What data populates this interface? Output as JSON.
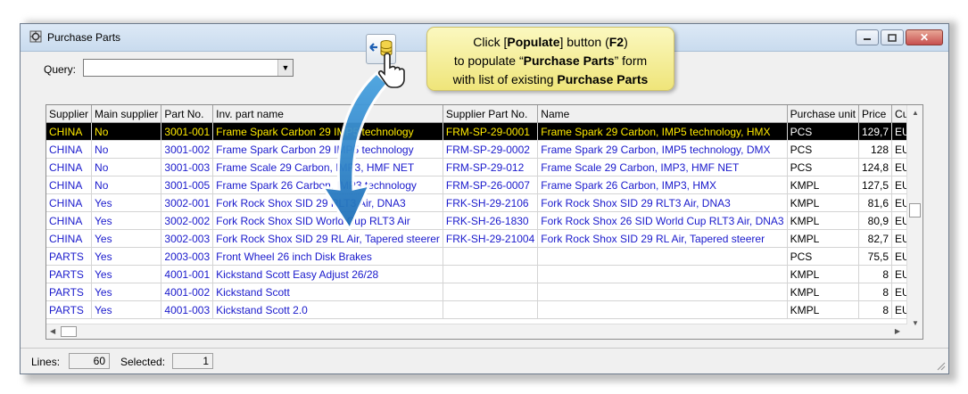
{
  "window": {
    "title": "Purchase Parts",
    "close_glyph": "✕"
  },
  "query": {
    "label": "Query:",
    "value": ""
  },
  "callout": {
    "line1_pre": "Click [",
    "line1_bold1": "Populate",
    "line1_mid": "] button (",
    "line1_bold2": "F2",
    "line1_post": ")",
    "line2_pre": "to populate “",
    "line2_bold": "Purchase Parts",
    "line2_post": "” form",
    "line3_pre": "with list of existing ",
    "line3_bold": "Purchase Parts"
  },
  "grid": {
    "columns": [
      "Supplier",
      "Main supplier",
      "Part No.",
      "Inv. part name",
      "Supplier Part No.",
      "Name",
      "Purchase unit",
      "Price",
      "Currency"
    ],
    "rows": [
      [
        "CHINA",
        "No",
        "3001-001",
        "Frame Spark Carbon 29 IMP5 technology",
        "FRM-SP-29-0001",
        "Frame Spark 29 Carbon, IMP5 technology, HMX",
        "PCS",
        "129,7",
        "EUR"
      ],
      [
        "CHINA",
        "No",
        "3001-002",
        "Frame Spark Carbon 29 IMP5 technology",
        "FRM-SP-29-0002",
        "Frame Spark 29 Carbon, IMP5 technology, DMX",
        "PCS",
        "128",
        "EUR"
      ],
      [
        "CHINA",
        "No",
        "3001-003",
        "Frame Scale 29 Carbon, IMP3, HMF NET",
        "FRM-SP-29-012",
        "Frame Scale 29 Carbon, IMP3, HMF NET",
        "PCS",
        "124,8",
        "EUR"
      ],
      [
        "CHINA",
        "No",
        "3001-005",
        "Frame Spark 26 Carbon, IMP3 technology",
        "FRM-SP-26-0007",
        "Frame Spark 26 Carbon, IMP3, HMX",
        "KMPL",
        "127,5",
        "EUR"
      ],
      [
        "CHINA",
        "Yes",
        "3002-001",
        "Fork Rock Shox SID 29 RLT3 Air, DNA3",
        "FRK-SH-29-2106",
        "Fork Rock Shox SID 29 RLT3 Air, DNA3",
        "KMPL",
        "81,6",
        "EUR"
      ],
      [
        "CHINA",
        "Yes",
        "3002-002",
        "Fork Rock Shox SID World Cup RLT3 Air",
        "FRK-SH-26-1830",
        "Fork Rock Shox 26 SID World Cup RLT3 Air, DNA3",
        "KMPL",
        "80,9",
        "EUR"
      ],
      [
        "CHINA",
        "Yes",
        "3002-003",
        "Fork Rock Shox SID 29 RL Air, Tapered steerer",
        "FRK-SH-29-21004",
        "Fork Rock Shox SID 29 RL Air, Tapered steerer",
        "KMPL",
        "82,7",
        "EUR"
      ],
      [
        "PARTS",
        "Yes",
        "2003-003",
        "Front Wheel 26 inch Disk Brakes",
        "",
        "",
        "PCS",
        "75,5",
        "EUR"
      ],
      [
        "PARTS",
        "Yes",
        "4001-001",
        "Kickstand Scott Easy Adjust 26/28",
        "",
        "",
        "KMPL",
        "8",
        "EUR"
      ],
      [
        "PARTS",
        "Yes",
        "4001-002",
        "Kickstand Scott",
        "",
        "",
        "KMPL",
        "8",
        "EUR"
      ],
      [
        "PARTS",
        "Yes",
        "4001-003",
        "Kickstand Scott 2.0",
        "",
        "",
        "KMPL",
        "8",
        "EUR"
      ]
    ]
  },
  "status": {
    "lines_label": "Lines:",
    "lines_value": "60",
    "selected_label": "Selected:",
    "selected_value": "1"
  },
  "colors": {
    "row_text": "#1a1acc",
    "selected_bg": "#000000",
    "selected_text": "#ffea00",
    "callout_bg": "#f5ef9c"
  },
  "icons": {
    "populate": "database-populate-icon",
    "hand": "hand-pointer-icon"
  }
}
